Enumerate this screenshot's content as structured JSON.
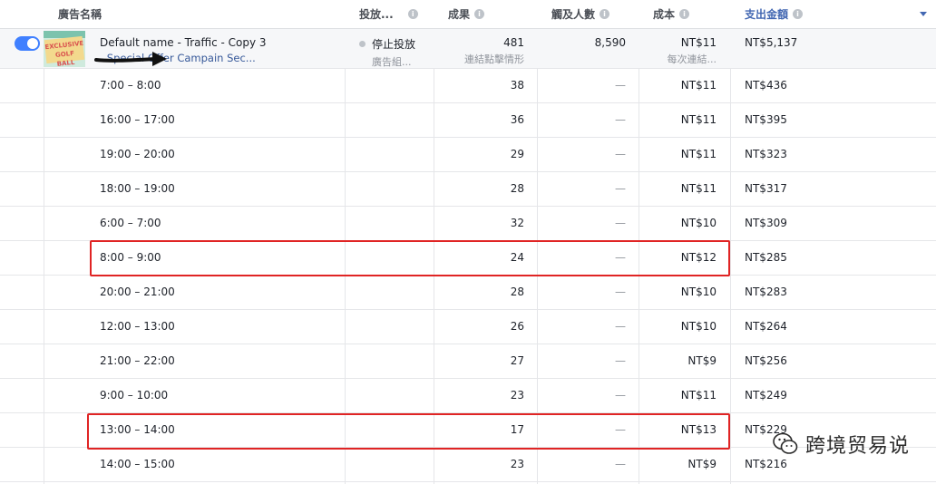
{
  "columns": {
    "ad_name": "廣告名稱",
    "delivery": "投放...",
    "results": "成果",
    "reach": "觸及人數",
    "cost": "成本",
    "spend": "支出金額"
  },
  "summary": {
    "thumb_text": "EXCLUSIVE GOLF BALL",
    "name": "Default name - Traffic - Copy 3",
    "campaign": "- Special Offer Campain Sec...",
    "delivery_status": "停止投放",
    "delivery_sub": "廣告組...",
    "results": "481",
    "results_sub": "連結點擊情形",
    "reach": "8,590",
    "cost": "NT$11",
    "cost_sub": "每次連結...",
    "spend": "NT$5,137"
  },
  "rows": [
    {
      "time": "7:00 – 8:00",
      "results": "38",
      "reach": "—",
      "cost": "NT$11",
      "spend": "NT$436"
    },
    {
      "time": "16:00 – 17:00",
      "results": "36",
      "reach": "—",
      "cost": "NT$11",
      "spend": "NT$395"
    },
    {
      "time": "19:00 – 20:00",
      "results": "29",
      "reach": "—",
      "cost": "NT$11",
      "spend": "NT$323"
    },
    {
      "time": "18:00 – 19:00",
      "results": "28",
      "reach": "—",
      "cost": "NT$11",
      "spend": "NT$317"
    },
    {
      "time": "6:00 – 7:00",
      "results": "32",
      "reach": "—",
      "cost": "NT$10",
      "spend": "NT$309"
    },
    {
      "time": "8:00 – 9:00",
      "results": "24",
      "reach": "—",
      "cost": "NT$12",
      "spend": "NT$285"
    },
    {
      "time": "20:00 – 21:00",
      "results": "28",
      "reach": "—",
      "cost": "NT$10",
      "spend": "NT$283"
    },
    {
      "time": "12:00 – 13:00",
      "results": "26",
      "reach": "—",
      "cost": "NT$10",
      "spend": "NT$264"
    },
    {
      "time": "21:00 – 22:00",
      "results": "27",
      "reach": "—",
      "cost": "NT$9",
      "spend": "NT$256"
    },
    {
      "time": "9:00 – 10:00",
      "results": "23",
      "reach": "—",
      "cost": "NT$11",
      "spend": "NT$249"
    },
    {
      "time": "13:00 – 14:00",
      "results": "17",
      "reach": "—",
      "cost": "NT$13",
      "spend": "NT$229"
    },
    {
      "time": "14:00 – 15:00",
      "results": "23",
      "reach": "—",
      "cost": "NT$9",
      "spend": "NT$216"
    }
  ],
  "watermark": "跨境贸易说",
  "colors": {
    "accent": "#4267b2",
    "toggle": "#4080ff",
    "highlight": "#e02424"
  }
}
